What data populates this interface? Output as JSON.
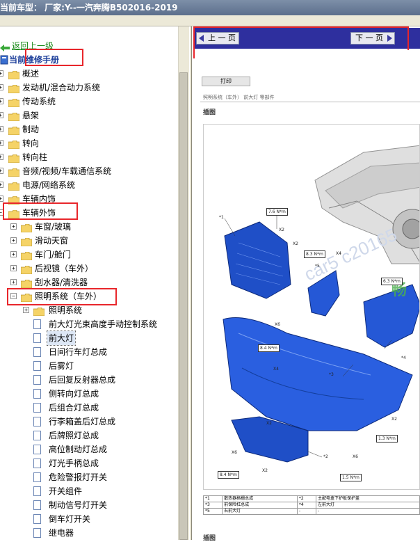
{
  "window": {
    "title": "当前车型： 厂家:Y--一汽奔腾B502016-2019"
  },
  "tree": {
    "up_link": "返回上一级",
    "root_label": "当前维修手册",
    "items": [
      {
        "label": "概述"
      },
      {
        "label": "发动机/混合动力系统"
      },
      {
        "label": "传动系统"
      },
      {
        "label": "悬架"
      },
      {
        "label": "制动"
      },
      {
        "label": "转向"
      },
      {
        "label": "转向柱"
      },
      {
        "label": "音频/视频/车载通信系统"
      },
      {
        "label": "电源/网络系统"
      },
      {
        "label": "车辆内饰"
      },
      {
        "label": "车辆外饰"
      }
    ],
    "exterior_children": [
      {
        "label": "车窗/玻璃"
      },
      {
        "label": "滑动天窗"
      },
      {
        "label": "车门/舱门"
      },
      {
        "label": "后视镜（车外）"
      },
      {
        "label": "刮水器/清洗器"
      },
      {
        "label": "照明系统（车外）"
      }
    ],
    "lighting_children": [
      {
        "label": "照明系统"
      },
      {
        "label": "前大灯光束高度手动控制系统"
      },
      {
        "label": "前大灯"
      },
      {
        "label": "日间行车灯总成"
      },
      {
        "label": "后雾灯"
      },
      {
        "label": "后回复反射器总成"
      },
      {
        "label": "侧转向灯总成"
      },
      {
        "label": "后组合灯总成"
      },
      {
        "label": "行李箱盖后灯总成"
      },
      {
        "label": "后牌照灯总成"
      },
      {
        "label": "高位制动灯总成"
      },
      {
        "label": "灯光手柄总成"
      },
      {
        "label": "危险警报灯开关"
      },
      {
        "label": "开关组件"
      },
      {
        "label": "制动信号灯开关"
      },
      {
        "label": "倒车灯开关"
      },
      {
        "label": "继电器"
      }
    ]
  },
  "nav": {
    "prev_label": "上 一 页",
    "next_label": "下 一 页"
  },
  "document": {
    "print_label": "打印",
    "breadcrumb": "照明系统（车外） 前大灯 零部件",
    "section_title": "插图",
    "section_title_2": "插图",
    "torque_labels": [
      "7.6 N*m",
      "8.3 N*m",
      "8.4 N*m",
      "1.3 N*m",
      "8.4 N*m",
      "1.5 N*m",
      "6.3 N*m"
    ],
    "part_markers": [
      "*1",
      "*2",
      "*3",
      "*4",
      "*5"
    ],
    "qty_labels": [
      "X2",
      "X2",
      "X4",
      "X6",
      "X4",
      "X2",
      "X2",
      "X6",
      "X2",
      "X6"
    ],
    "watermark": "car5 c20165",
    "legend": [
      {
        "n1": "*1",
        "t1": "散热器格栅总成",
        "n2": "*2",
        "t2": "主配电盒下护板保护盖"
      },
      {
        "n1": "*3",
        "t1": "前保险杠总成",
        "n2": "*4",
        "t2": "左前大灯"
      },
      {
        "n1": "*5",
        "t1": "右前大灯",
        "n2": "-",
        "t2": "-"
      }
    ]
  }
}
